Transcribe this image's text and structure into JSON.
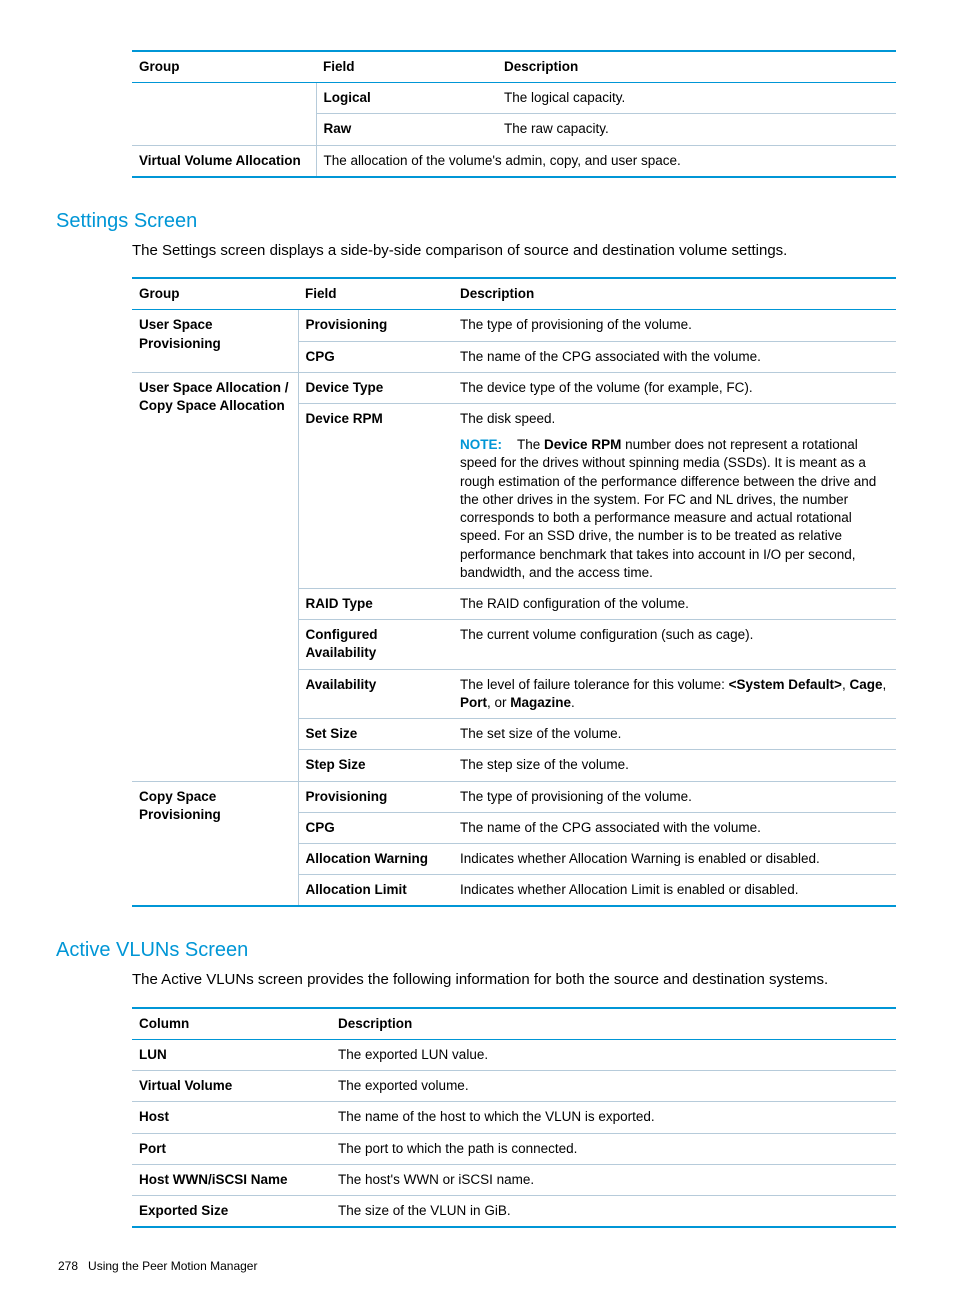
{
  "table1": {
    "headers": {
      "group": "Group",
      "field": "Field",
      "desc": "Description"
    },
    "rows": [
      {
        "group": "",
        "field": "Logical",
        "desc": "The logical capacity."
      },
      {
        "group": "",
        "field": "Raw",
        "desc": "The raw capacity."
      }
    ],
    "last": {
      "group": "Virtual Volume Allocation",
      "desc": "The allocation of the volume's admin, copy, and user space."
    }
  },
  "settings": {
    "heading": "Settings Screen",
    "intro": "The Settings screen displays a side-by-side comparison of source and destination volume settings.",
    "headers": {
      "group": "Group",
      "field": "Field",
      "desc": "Description"
    },
    "g1": {
      "label": "User Space Provisioning",
      "r0": {
        "field": "Provisioning",
        "desc": "The type of provisioning of the volume."
      },
      "r1": {
        "field": "CPG",
        "desc": "The name of the CPG associated with the volume."
      }
    },
    "g2": {
      "label": "User Space Allocation / Copy Space Allocation",
      "r0": {
        "field": "Device Type",
        "desc": "The device type of the volume (for example, FC)."
      },
      "r1": {
        "field": "Device RPM",
        "desc": "The disk speed.",
        "note_label": "NOTE:",
        "note_pre": "The ",
        "note_bold": "Device RPM",
        "note_post": " number does not represent a rotational speed for the drives without spinning media (SSDs). It is meant as a rough estimation of the performance difference between the drive and the other drives in the system. For FC and NL drives, the number corresponds to both a performance measure and actual rotational speed. For an SSD drive, the number is to be treated as relative performance benchmark that takes into account in I/O per second, bandwidth, and the access time."
      },
      "r2": {
        "field": "RAID Type",
        "desc": "The RAID configuration of the volume."
      },
      "r3": {
        "field": "Configured Availability",
        "desc": "The current volume configuration (such as cage)."
      },
      "r4": {
        "field": "Availability",
        "pre": "The level of failure tolerance for this volume: ",
        "b1": "<System Default>",
        "s1": ", ",
        "b2": "Cage",
        "s2": ", ",
        "b3": "Port",
        "s3": ", or ",
        "b4": "Magazine",
        "s4": "."
      },
      "r5": {
        "field": "Set Size",
        "desc": "The set size of the volume."
      },
      "r6": {
        "field": "Step Size",
        "desc": "The step size of the volume."
      }
    },
    "g3": {
      "label": "Copy Space Provisioning",
      "r0": {
        "field": "Provisioning",
        "desc": "The type of provisioning of the volume."
      },
      "r1": {
        "field": "CPG",
        "desc": "The name of the CPG associated with the volume."
      },
      "r2": {
        "field": "Allocation Warning",
        "desc": "Indicates whether Allocation Warning is enabled or disabled."
      },
      "r3": {
        "field": "Allocation Limit",
        "desc": "Indicates whether Allocation Limit is enabled or disabled."
      }
    }
  },
  "vluns": {
    "heading": "Active VLUNs Screen",
    "intro": "The Active VLUNs screen provides the following information for both the source and destination systems.",
    "headers": {
      "col": "Column",
      "desc": "Description"
    },
    "rows": {
      "r0": {
        "col": "LUN",
        "desc": "The exported LUN value."
      },
      "r1": {
        "col": "Virtual Volume",
        "desc": "The exported volume."
      },
      "r2": {
        "col": "Host",
        "desc": "The name of the host to which the VLUN is exported."
      },
      "r3": {
        "col": "Port",
        "desc": "The port to which the path is connected."
      },
      "r4": {
        "col": "Host WWN/iSCSI Name",
        "desc": "The host's WWN or iSCSI name."
      },
      "r5": {
        "col": "Exported Size",
        "desc": "The size of the VLUN in GiB."
      }
    }
  },
  "footer": {
    "page": "278",
    "title": "Using the Peer Motion Manager"
  }
}
